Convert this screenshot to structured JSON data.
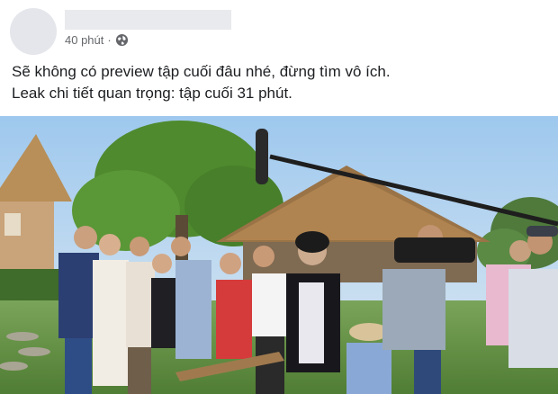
{
  "post": {
    "timestamp": "40 phút",
    "separator": "·",
    "privacy_icon": "globe-icon",
    "lines": [
      "Sẽ không có preview tập cuối đâu nhé, đừng tìm vô ích.",
      "Leak chi tiết quan trọng: tập cuối 31 phút."
    ]
  },
  "colors": {
    "text": "#1c1e21",
    "secondary": "#65676b",
    "placeholder": "#e4e6eb"
  }
}
